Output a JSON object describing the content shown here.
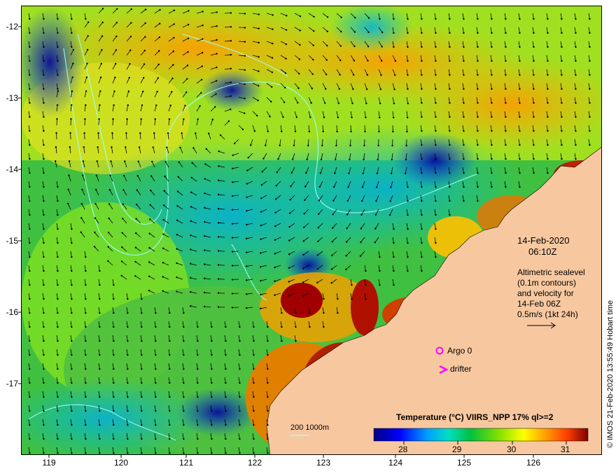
{
  "map": {
    "y_ticks": [
      "-12",
      "-13",
      "-14",
      "-15",
      "-16",
      "-17"
    ],
    "x_ticks": [
      "119",
      "120",
      "121",
      "122",
      "123",
      "124",
      "125",
      "126"
    ]
  },
  "annotations": {
    "date": "14-Feb-2020",
    "time": "06:10Z",
    "legend_lines": [
      "Altimetric sealevel",
      "(0.1m contours)",
      "and velocity for",
      "14-Feb 06Z",
      "0.5m/s (1kt 24h)"
    ],
    "argo_label": "Argo 0",
    "drifter_label": "drifter",
    "depth_label": "200  1000m"
  },
  "colorbar": {
    "title": "Temperature (°C) VIIRS_NPP 17% ql>=2",
    "ticks": [
      "28",
      "29",
      "30",
      "31"
    ],
    "range": [
      27.3,
      31.4
    ],
    "colors": [
      "#000080",
      "#0000ff",
      "#00a0ff",
      "#00e0c0",
      "#00c040",
      "#80e000",
      "#ffff00",
      "#ffa000",
      "#ff4000",
      "#800000"
    ]
  },
  "credit": "© IMOS 21-Feb-2020 13:55:49 Hobart time",
  "colors": {
    "land": "#f7c8a0",
    "argo_marker": "#ff00ff",
    "drifter_marker": "#ff00ff",
    "contour": "#a0ffff"
  }
}
